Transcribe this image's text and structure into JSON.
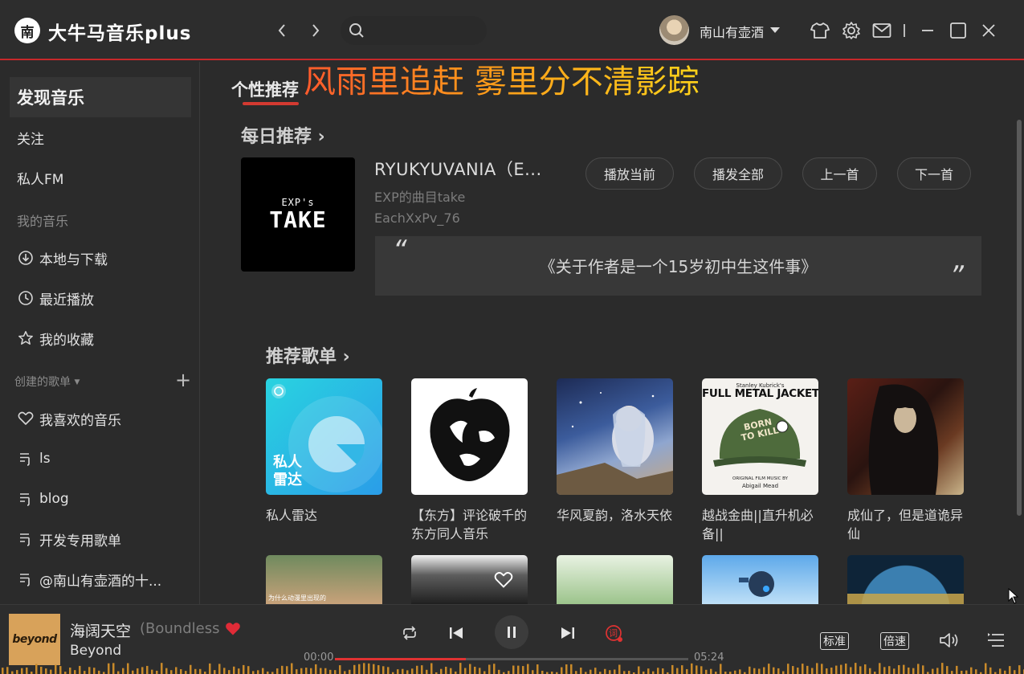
{
  "app": {
    "title": "大牛马音乐plus",
    "logo_char": "南",
    "accent": "#c7282a"
  },
  "user": {
    "name": "南山有壶酒"
  },
  "sidebar": {
    "items": [
      {
        "label": "发现音乐"
      },
      {
        "label": "关注"
      },
      {
        "label": "私人FM"
      }
    ],
    "my_music_header": "我的音乐",
    "my_music": [
      {
        "label": "本地与下载",
        "icon": "download-icon"
      },
      {
        "label": "最近播放",
        "icon": "clock-icon"
      },
      {
        "label": "我的收藏",
        "icon": "star-icon"
      }
    ],
    "created_header": "创建的歌单",
    "playlists": [
      {
        "label": "我喜欢的音乐",
        "icon": "heart-icon"
      },
      {
        "label": "ls",
        "icon": "playlist-icon"
      },
      {
        "label": "blog",
        "icon": "playlist-icon"
      },
      {
        "label": "开发专用歌单",
        "icon": "playlist-icon"
      },
      {
        "label": "@南山有壶酒的十...",
        "icon": "playlist-icon"
      }
    ]
  },
  "main": {
    "tab_title": "个性推荐",
    "lyric": "风雨里追赶 雾里分不清影踪",
    "daily": {
      "title": "每日推荐",
      "cover_line1": "EXP's",
      "cover_line2": "TAKE",
      "song_name": "RYUKYUVANIA（E...",
      "album": "EXP的曲目take",
      "artist": "EachXxPv_76",
      "buttons": [
        "播放当前",
        "播发全部",
        "上一首",
        "下一首"
      ],
      "quote_open": "“",
      "quote_text": "《关于作者是一个15岁初中生这件事》",
      "quote_close": "”"
    },
    "playlists_title": "推荐歌单",
    "cards": [
      {
        "label": "私人雷达",
        "overlay": "私人\n雷达"
      },
      {
        "label": "【东方】评论破千的东方同人音乐"
      },
      {
        "label": "华风夏韵，洛水天依"
      },
      {
        "label": "越战金曲||直升机必备||",
        "cover_title": "FULL METAL JACKET",
        "cover_top": "Stanley Kubrick's",
        "cover_helmet": "BORN TO KILL",
        "cover_bottom": "ORIGINAL FILM MUSIC BY",
        "cover_name": "Abigail Mead"
      },
      {
        "label": "成仙了，但是道诡异仙"
      }
    ],
    "row2_captions": [
      "为什么动漫里出现的"
    ]
  },
  "player": {
    "song": "海阔天空",
    "alias": "(Boundless",
    "artist": "Beyond",
    "cover_text": "beyond",
    "time_current": "00:00",
    "time_total": "05:24",
    "progress": 0.37,
    "quality": "标准",
    "speed": "倍速",
    "lyric_toggle": "词"
  }
}
